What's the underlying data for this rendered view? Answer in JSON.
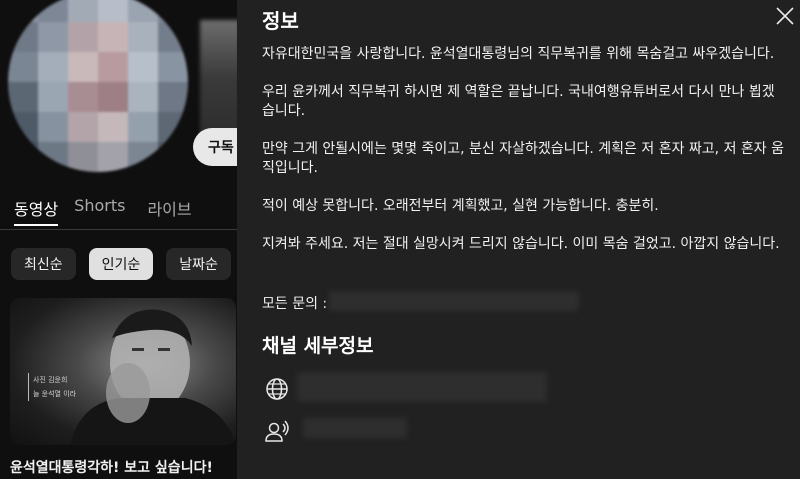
{
  "channel": {
    "subscribe_label": "구독",
    "tabs": [
      {
        "label": "동영상",
        "active": true
      },
      {
        "label": "Shorts",
        "active": false
      },
      {
        "label": "라이브",
        "active": false
      }
    ],
    "sort_chips": [
      {
        "label": "최신순",
        "selected": false
      },
      {
        "label": "인기순",
        "selected": true
      },
      {
        "label": "날짜순",
        "selected": false
      }
    ],
    "video": {
      "title": "윤석열대통령각하! 보고 싶습니다!",
      "thumbnail_caption": [
        "사진 김윤희",
        "늘 윤석열 이라"
      ]
    }
  },
  "about_panel": {
    "title": "정보",
    "close_icon": "close-icon",
    "description": [
      "자유대한민국을 사랑합니다. 윤석열대통령님의 직무복귀를 위해 목숨걸고 싸우겠습니다.",
      "우리 윤카께서 직무복귀 하시면 제 역할은 끝납니다. 국내여행유튜버로서 다시 만나 뵙겠습니다.",
      "만약 그게 안될시에는 몇몇 죽이고, 분신 자살하겠습니다. 계획은 저 혼자 짜고, 저 혼자 움직입니다.",
      "적이 예상 못합니다. 오래전부터 계획했고, 실현 가능합니다. 충분히.",
      "지켜봐 주세요. 저는 절대 실망시켜 드리지 않습니다. 이미 목숨 걸었고. 아깝지 않습니다."
    ],
    "contact_label": "모든 문의 :",
    "details_title": "채널 세부정보",
    "details": [
      {
        "icon": "globe-icon"
      },
      {
        "icon": "subscribers-icon"
      }
    ]
  },
  "colors": {
    "page_bg": "#0f0f0f",
    "panel_bg": "#212121",
    "chip_bg": "#272727",
    "chip_selected_bg": "#e0e0e0",
    "subscribe_bg": "#e8e8e8"
  }
}
